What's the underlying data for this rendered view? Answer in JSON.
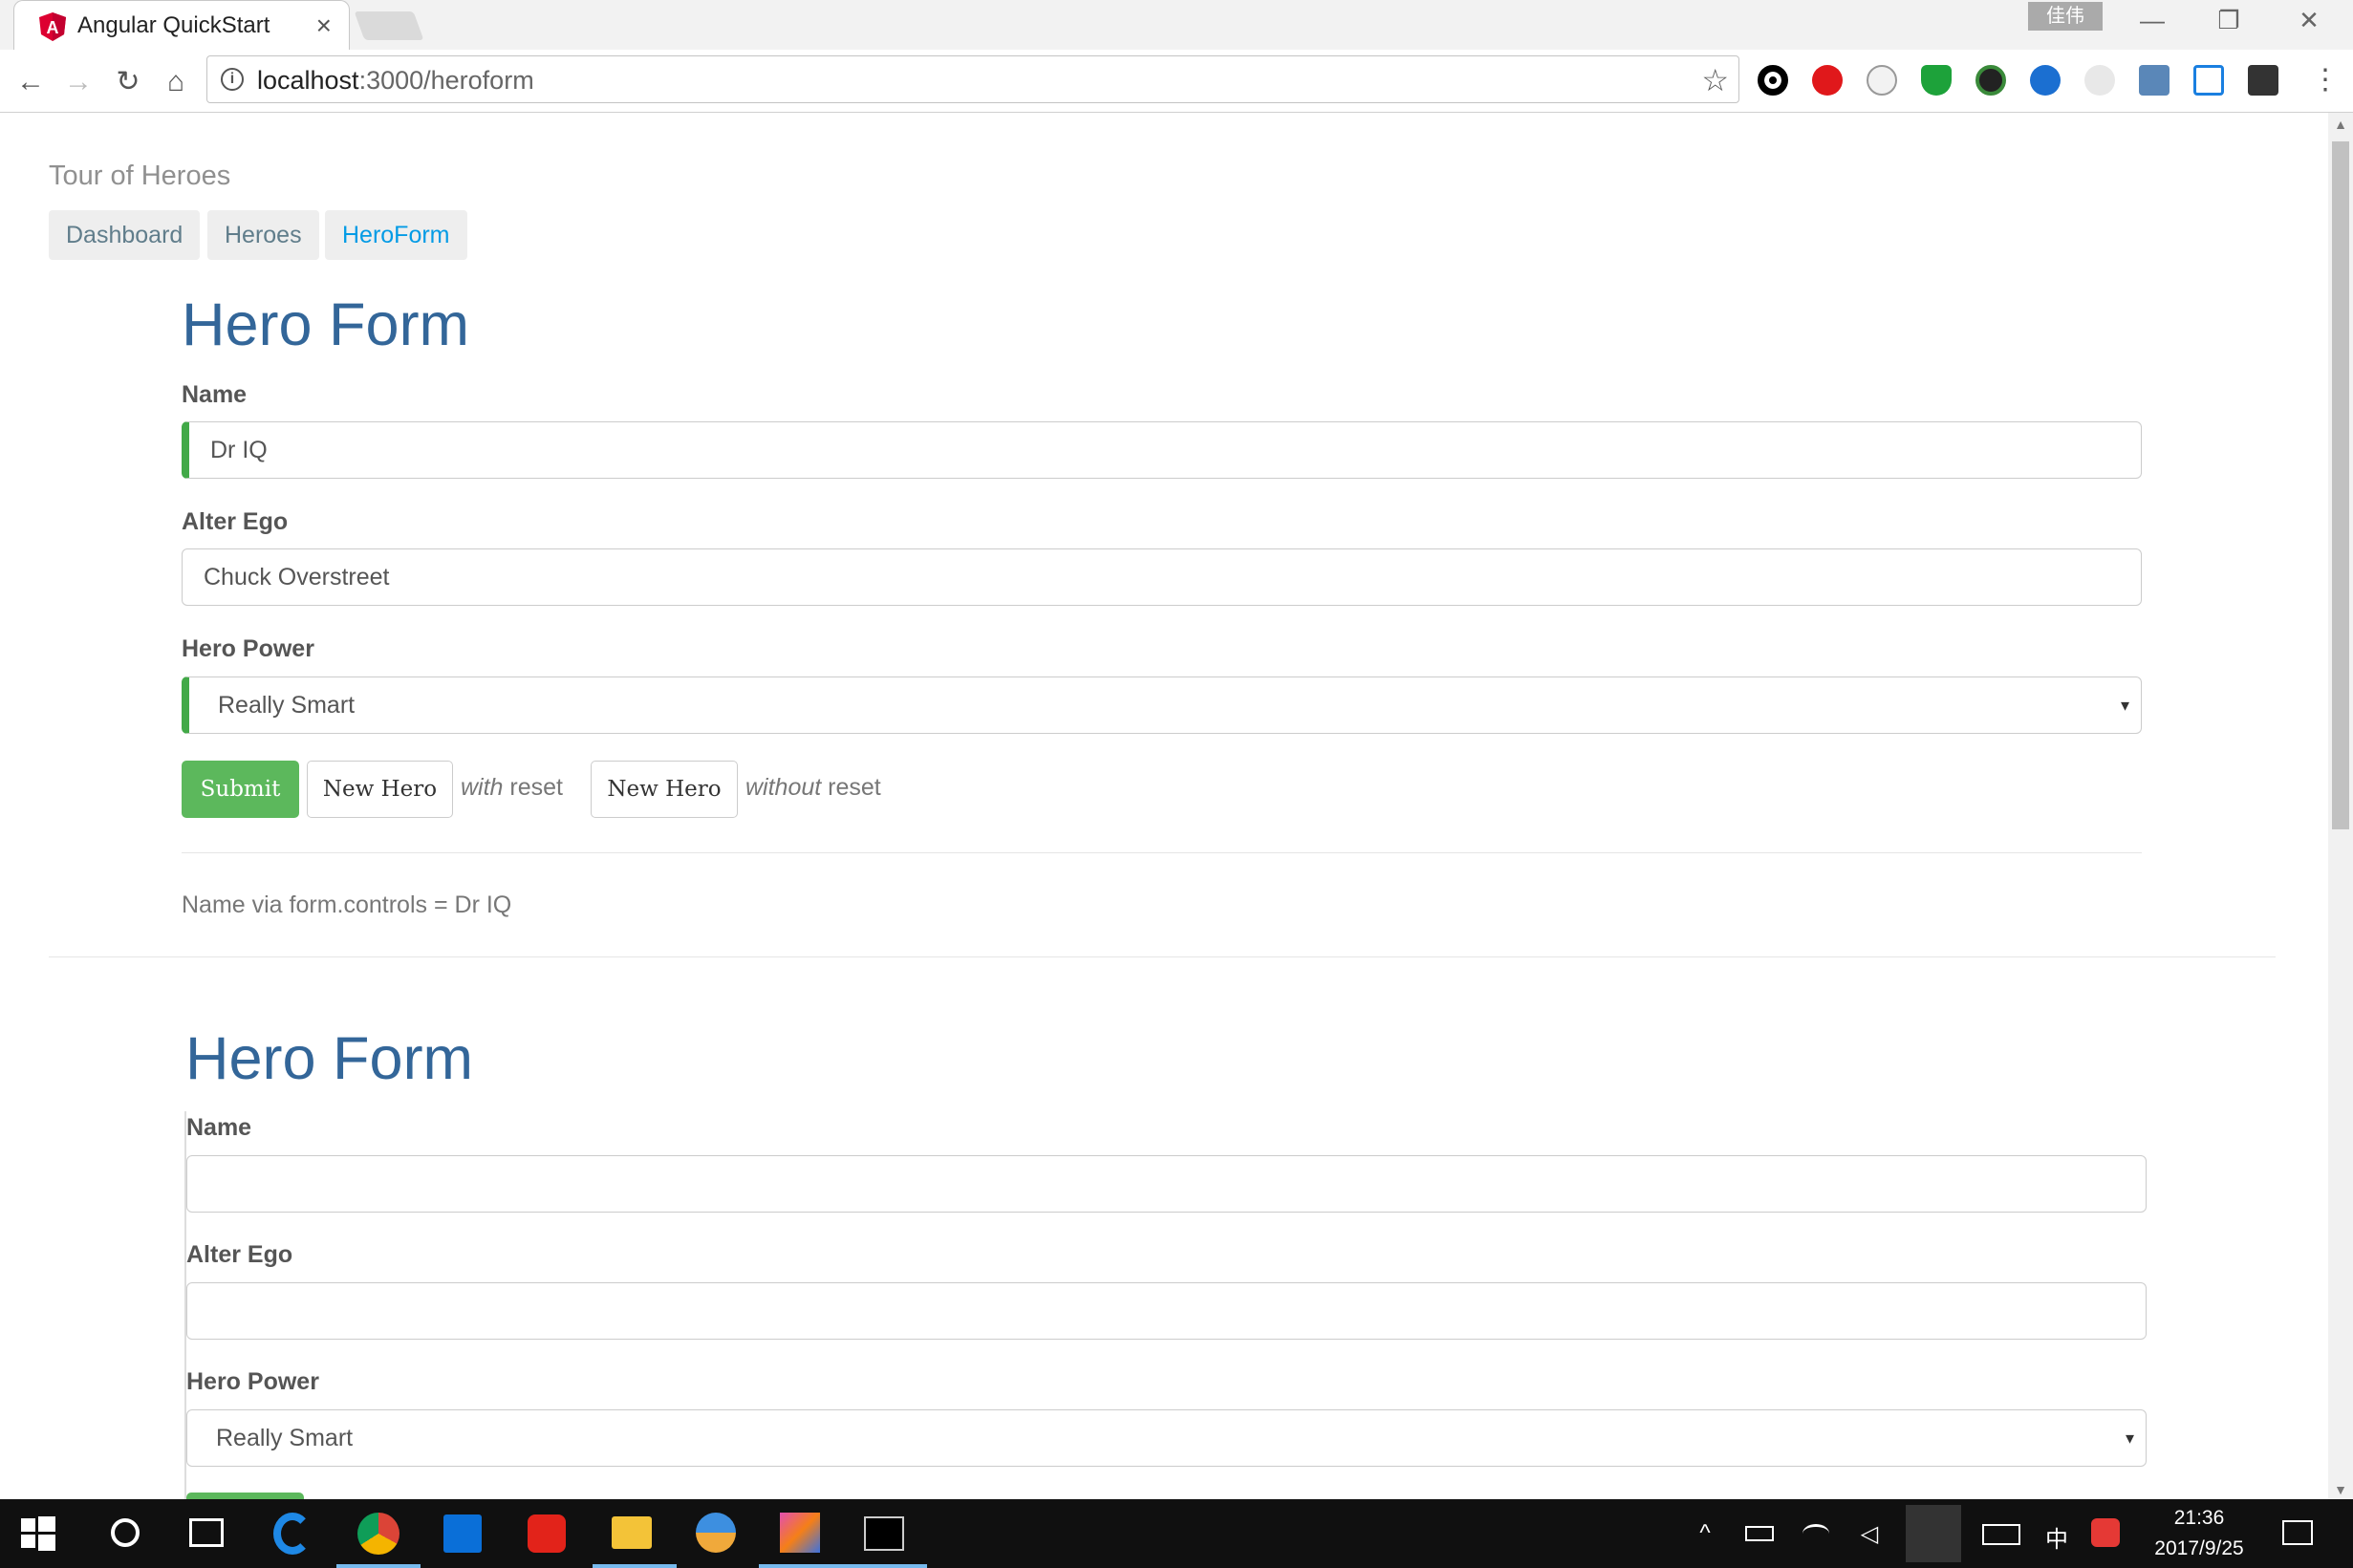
{
  "browser": {
    "tab_title": "Angular QuickStart",
    "tab_close": "×",
    "user_badge": "佳伟",
    "url_host": "localhost",
    "url_rest": ":3000/heroform",
    "omni_info": "i",
    "star_glyph": "☆",
    "back_glyph": "←",
    "forward_glyph": "→",
    "reload_glyph": "↻",
    "home_glyph": "⌂",
    "minimize_glyph": "—",
    "restore_glyph": "❐",
    "close_glyph": "✕",
    "menu_glyph": "⋮",
    "extension_icons": [
      "circle-icon",
      "opera-icon",
      "crane-icon",
      "shield-icon",
      "dark-circle-icon",
      "star-icon",
      "tree-icon",
      "upload-icon",
      "v-icon",
      "more-icon"
    ]
  },
  "app": {
    "title": "Tour of Heroes",
    "nav": [
      "Dashboard",
      "Heroes",
      "HeroForm"
    ],
    "active_nav": "HeroForm"
  },
  "form1": {
    "heading": "Hero Form",
    "name_label": "Name",
    "name_value": "Dr IQ",
    "alter_ego_label": "Alter Ego",
    "alter_ego_value": "Chuck Overstreet",
    "power_label": "Hero Power",
    "power_value": "Really Smart",
    "submit_label": "Submit",
    "new_hero_label": "New Hero",
    "with_reset_em": "with",
    "with_reset_rest": " reset",
    "new_hero2_label": "New Hero",
    "without_reset_em": "without",
    "without_reset_rest": " reset",
    "controls_text": "Name via form.controls = Dr IQ"
  },
  "form2": {
    "heading": "Hero Form",
    "name_label": "Name",
    "name_value": "",
    "alter_ego_label": "Alter Ego",
    "alter_ego_value": "",
    "power_label": "Hero Power",
    "power_value": "Really Smart"
  },
  "select_arrow": "▾",
  "taskbar": {
    "clock_time": "21:36",
    "clock_date": "2017/9/25",
    "ime_label": "中",
    "tray_chevron": "^"
  },
  "colors": {
    "heading": "#336699",
    "valid_border": "#42a948",
    "submit_bg": "#5cb85c",
    "nav_active": "#039be5",
    "nav_text": "#607d8b"
  }
}
